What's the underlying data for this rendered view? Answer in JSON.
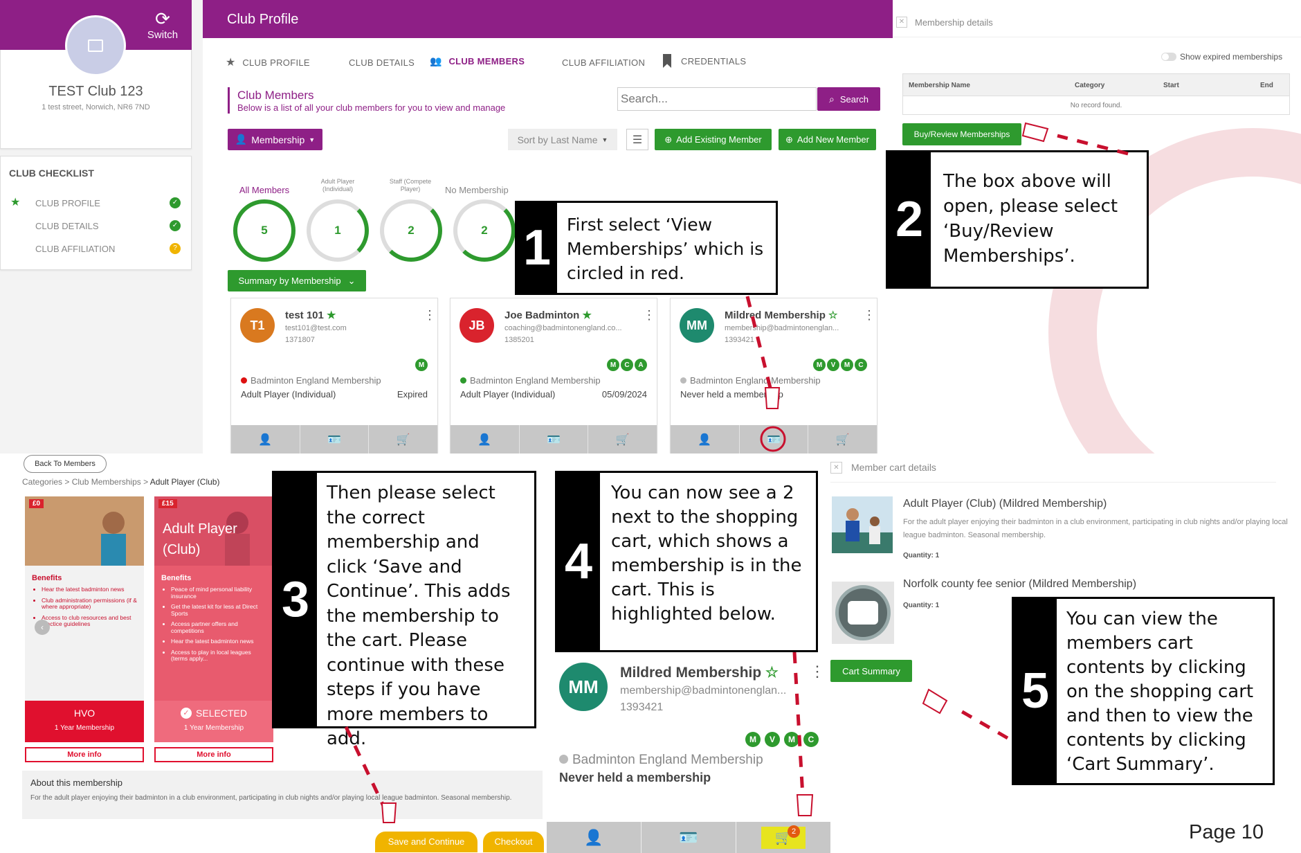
{
  "topbar": {
    "title": "Club Profile",
    "switch_label": "Switch"
  },
  "club": {
    "name": "TEST Club 123",
    "address": "1 test street, Norwich, NR6 7ND"
  },
  "checklist": {
    "title": "CLUB CHECKLIST",
    "items": [
      {
        "label": "CLUB PROFILE"
      },
      {
        "label": "CLUB DETAILS"
      },
      {
        "label": "CLUB AFFILIATION"
      }
    ]
  },
  "tabs": [
    {
      "label": "CLUB PROFILE"
    },
    {
      "label": "CLUB DETAILS"
    },
    {
      "label": "CLUB MEMBERS"
    },
    {
      "label": "CLUB AFFILIATION"
    },
    {
      "label": "CREDENTIALS"
    }
  ],
  "members_section": {
    "title": "Club Members",
    "subtitle": "Below is a list of all your club members for you to view and manage",
    "search_placeholder": "Search...",
    "search_button": "Search",
    "membership_button": "Membership",
    "sort_label": "Sort by Last Name",
    "add_existing": "Add Existing Member",
    "add_new": "Add New Member",
    "summary_button": "Summary by Membership"
  },
  "summary": [
    {
      "label": "All Members",
      "count": "5"
    },
    {
      "label": "Adult Player (Individual)",
      "count": "1"
    },
    {
      "label": "Staff (Compete Player)",
      "count": "2"
    },
    {
      "label": "No Membership",
      "count": "2"
    }
  ],
  "members": [
    {
      "initials": "T1",
      "name": "test 101",
      "email": "test101@test.com",
      "id": "1371807",
      "membership": "Badminton England Membership",
      "type": "Adult Player (Individual)",
      "status": "Expired",
      "badges": [
        "M"
      ],
      "color": "#d9791f",
      "dot": "#d11"
    },
    {
      "initials": "JB",
      "name": "Joe Badminton",
      "email": "coaching@badmintonengland.co...",
      "id": "1385201",
      "membership": "Badminton England Membership",
      "type": "Adult Player (Individual)",
      "status": "05/09/2024",
      "badges": [
        "M",
        "C",
        "A"
      ],
      "color": "#d9232d",
      "dot": "#2e9a2e"
    },
    {
      "initials": "MM",
      "name": "Mildred Membership",
      "email": "membership@badmintonenglan...",
      "id": "1393421",
      "membership": "Badminton England Membership",
      "type": "Never held a membership",
      "status": "",
      "badges": [
        "M",
        "V",
        "M",
        "C"
      ],
      "color": "#1e8a6e",
      "dot": "#bbb"
    }
  ],
  "membership_panel": {
    "title": "Membership details",
    "toggle_label": "Show expired memberships",
    "columns": [
      "Membership Name",
      "Category",
      "Start",
      "End"
    ],
    "empty": "No record found.",
    "buy_button": "Buy/Review Memberships"
  },
  "shop": {
    "back": "Back To Members",
    "breadcrumb": "Categories > Club Memberships > ",
    "breadcrumb_current": "Adult Player (Club)",
    "products": [
      {
        "price": "£0",
        "title": "",
        "benefits_title": "Benefits",
        "benefits": [
          "Hear the latest badminton news",
          "Club administration permissions (if & where appropriate)",
          "Access to club resources and best practice guidelines"
        ],
        "footer_title": "HVO",
        "footer_sub": "1 Year Membership",
        "more": "More info"
      },
      {
        "price": "£15",
        "title": "Adult Player (Club)",
        "benefits_title": "Benefits",
        "benefits": [
          "Peace of mind personal liability insurance",
          "Get the latest kit for less at Direct Sports",
          "Access partner offers and competitions",
          "Hear the latest badminton news",
          "Access to play in local leagues (terms apply..."
        ],
        "footer_title": "SELECTED",
        "footer_sub": "1 Year Membership",
        "more": "More info"
      }
    ],
    "about_title": "About this membership",
    "about_text": "For the adult player enjoying their badminton in a club environment, participating in club nights and/or playing local league badminton. Seasonal membership.",
    "save_button": "Save and Continue",
    "checkout_button": "Checkout"
  },
  "zoom_member": {
    "initials": "MM",
    "name": "Mildred Membership",
    "email": "membership@badmintonenglan...",
    "id": "1393421",
    "badges": [
      "M",
      "V",
      "M",
      "C"
    ],
    "membership": "Badminton England Membership",
    "type": "Never held a membership",
    "cart_count": "2"
  },
  "cart_panel": {
    "title": "Member cart details",
    "items": [
      {
        "name": "Adult Player (Club) (Mildred Membership)",
        "desc": "For the adult player enjoying their badminton in a club environment, participating in club nights and/or playing local league badminton. Seasonal membership.",
        "qty": "Quantity: 1"
      },
      {
        "name": "Norfolk county fee senior (Mildred Membership)",
        "qty": "Quantity: 1"
      }
    ],
    "summary_button": "Cart Summary"
  },
  "callouts": [
    {
      "num": "1",
      "text": "First select ‘View Memberships’ which is circled in red."
    },
    {
      "num": "2",
      "text": "The box above will open, please select ‘Buy/Review Memberships’."
    },
    {
      "num": "3",
      "text": "Then please select the correct membership and click ‘Save and Continue’. This adds the membership to the cart. Please continue with these steps if you have more members to add."
    },
    {
      "num": "4",
      "text": "You can now see a 2 next to the shopping cart, which shows a membership is in the cart. This is highlighted below."
    },
    {
      "num": "5",
      "text": "You can view the members cart contents by clicking on the shopping cart and then to view the contents by clicking ‘Cart Summary’."
    }
  ],
  "page_label": "Page 10",
  "colors": {
    "purple": "#8e1f86",
    "green": "#2e9a2e",
    "orange": "#f0b400",
    "red": "#c8102e"
  }
}
